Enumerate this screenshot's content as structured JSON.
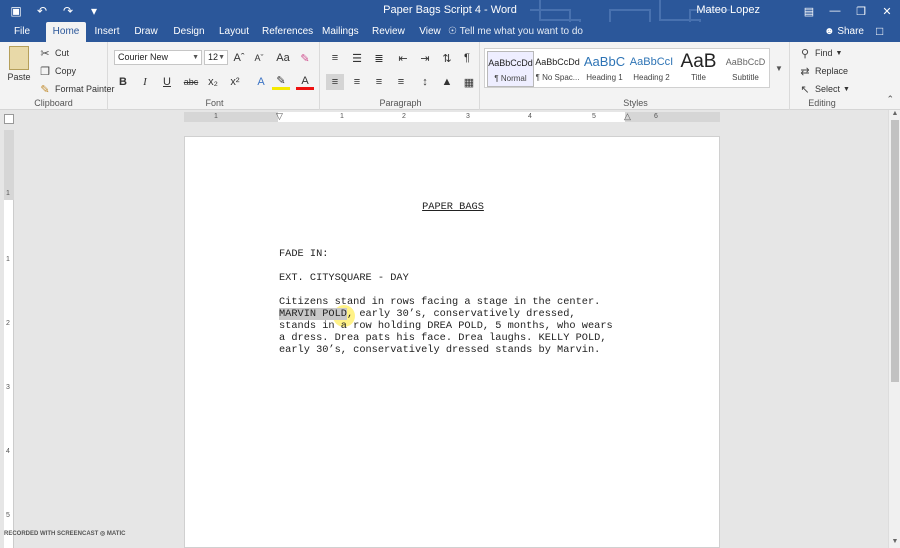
{
  "window": {
    "doc_title": "Paper Bags Script 4  -  Word",
    "user": "Mateo Lopez"
  },
  "qat": [
    {
      "icon": "save-icon",
      "glyph": "▣"
    },
    {
      "icon": "undo-icon",
      "glyph": "↶"
    },
    {
      "icon": "redo-icon",
      "glyph": "↷"
    },
    {
      "icon": "customize-qat-icon",
      "glyph": "▾"
    }
  ],
  "tabs": [
    "File",
    "Home",
    "Insert",
    "Draw",
    "Design",
    "Layout",
    "References",
    "Mailings",
    "Review",
    "View"
  ],
  "tell_me": "Tell me what you want to do",
  "share": "Share",
  "clipboard": {
    "paste": "Paste",
    "cut": "Cut",
    "copy": "Copy",
    "format_painter": "Format Painter",
    "label": "Clipboard"
  },
  "font": {
    "family": "Courier New",
    "size": "12",
    "label": "Font"
  },
  "paragraph": {
    "label": "Paragraph"
  },
  "styles": {
    "label": "Styles",
    "items": [
      {
        "sample": "AaBbCcDd",
        "name": "¶ Normal"
      },
      {
        "sample": "AaBbCcDd",
        "name": "¶ No Spac..."
      },
      {
        "sample": "AaBbC",
        "name": "Heading 1"
      },
      {
        "sample": "AaBbCcI",
        "name": "Heading 2"
      },
      {
        "sample": "AaB",
        "name": "Title"
      },
      {
        "sample": "AaBbCcD",
        "name": "Subtitle"
      }
    ]
  },
  "editing": {
    "find": "Find",
    "replace": "Replace",
    "select": "Select",
    "label": "Editing"
  },
  "ruler": {
    "marks": [
      "1",
      "1",
      "2",
      "3",
      "4",
      "5",
      "6"
    ],
    "vmarks": [
      "1",
      "1",
      "2",
      "3",
      "4",
      "5"
    ]
  },
  "document": {
    "title": "PAPER BAGS",
    "fade_in": "FADE IN:",
    "scene_heading": "EXT. CITYSQUARE - DAY",
    "action": [
      "Citizens stand in rows facing a stage in the center.",
      "MARVIN POLD, early 30’s, conservatively dressed,",
      "stands in a row holding DREA POLD, 5 months, who wears",
      "a dress. Drea pats his face. Drea laughs. KELLY POLD,",
      "early 30’s, conservatively dressed stands by Marvin."
    ],
    "highlighted": "MARVIN POLD"
  },
  "watermark": "RECORDED WITH SCREENCAST ◎ MATIC",
  "colors": {
    "titlebar": "#2b579a",
    "ribbon": "#f3f3f3",
    "canvas": "#e6e6e6"
  }
}
